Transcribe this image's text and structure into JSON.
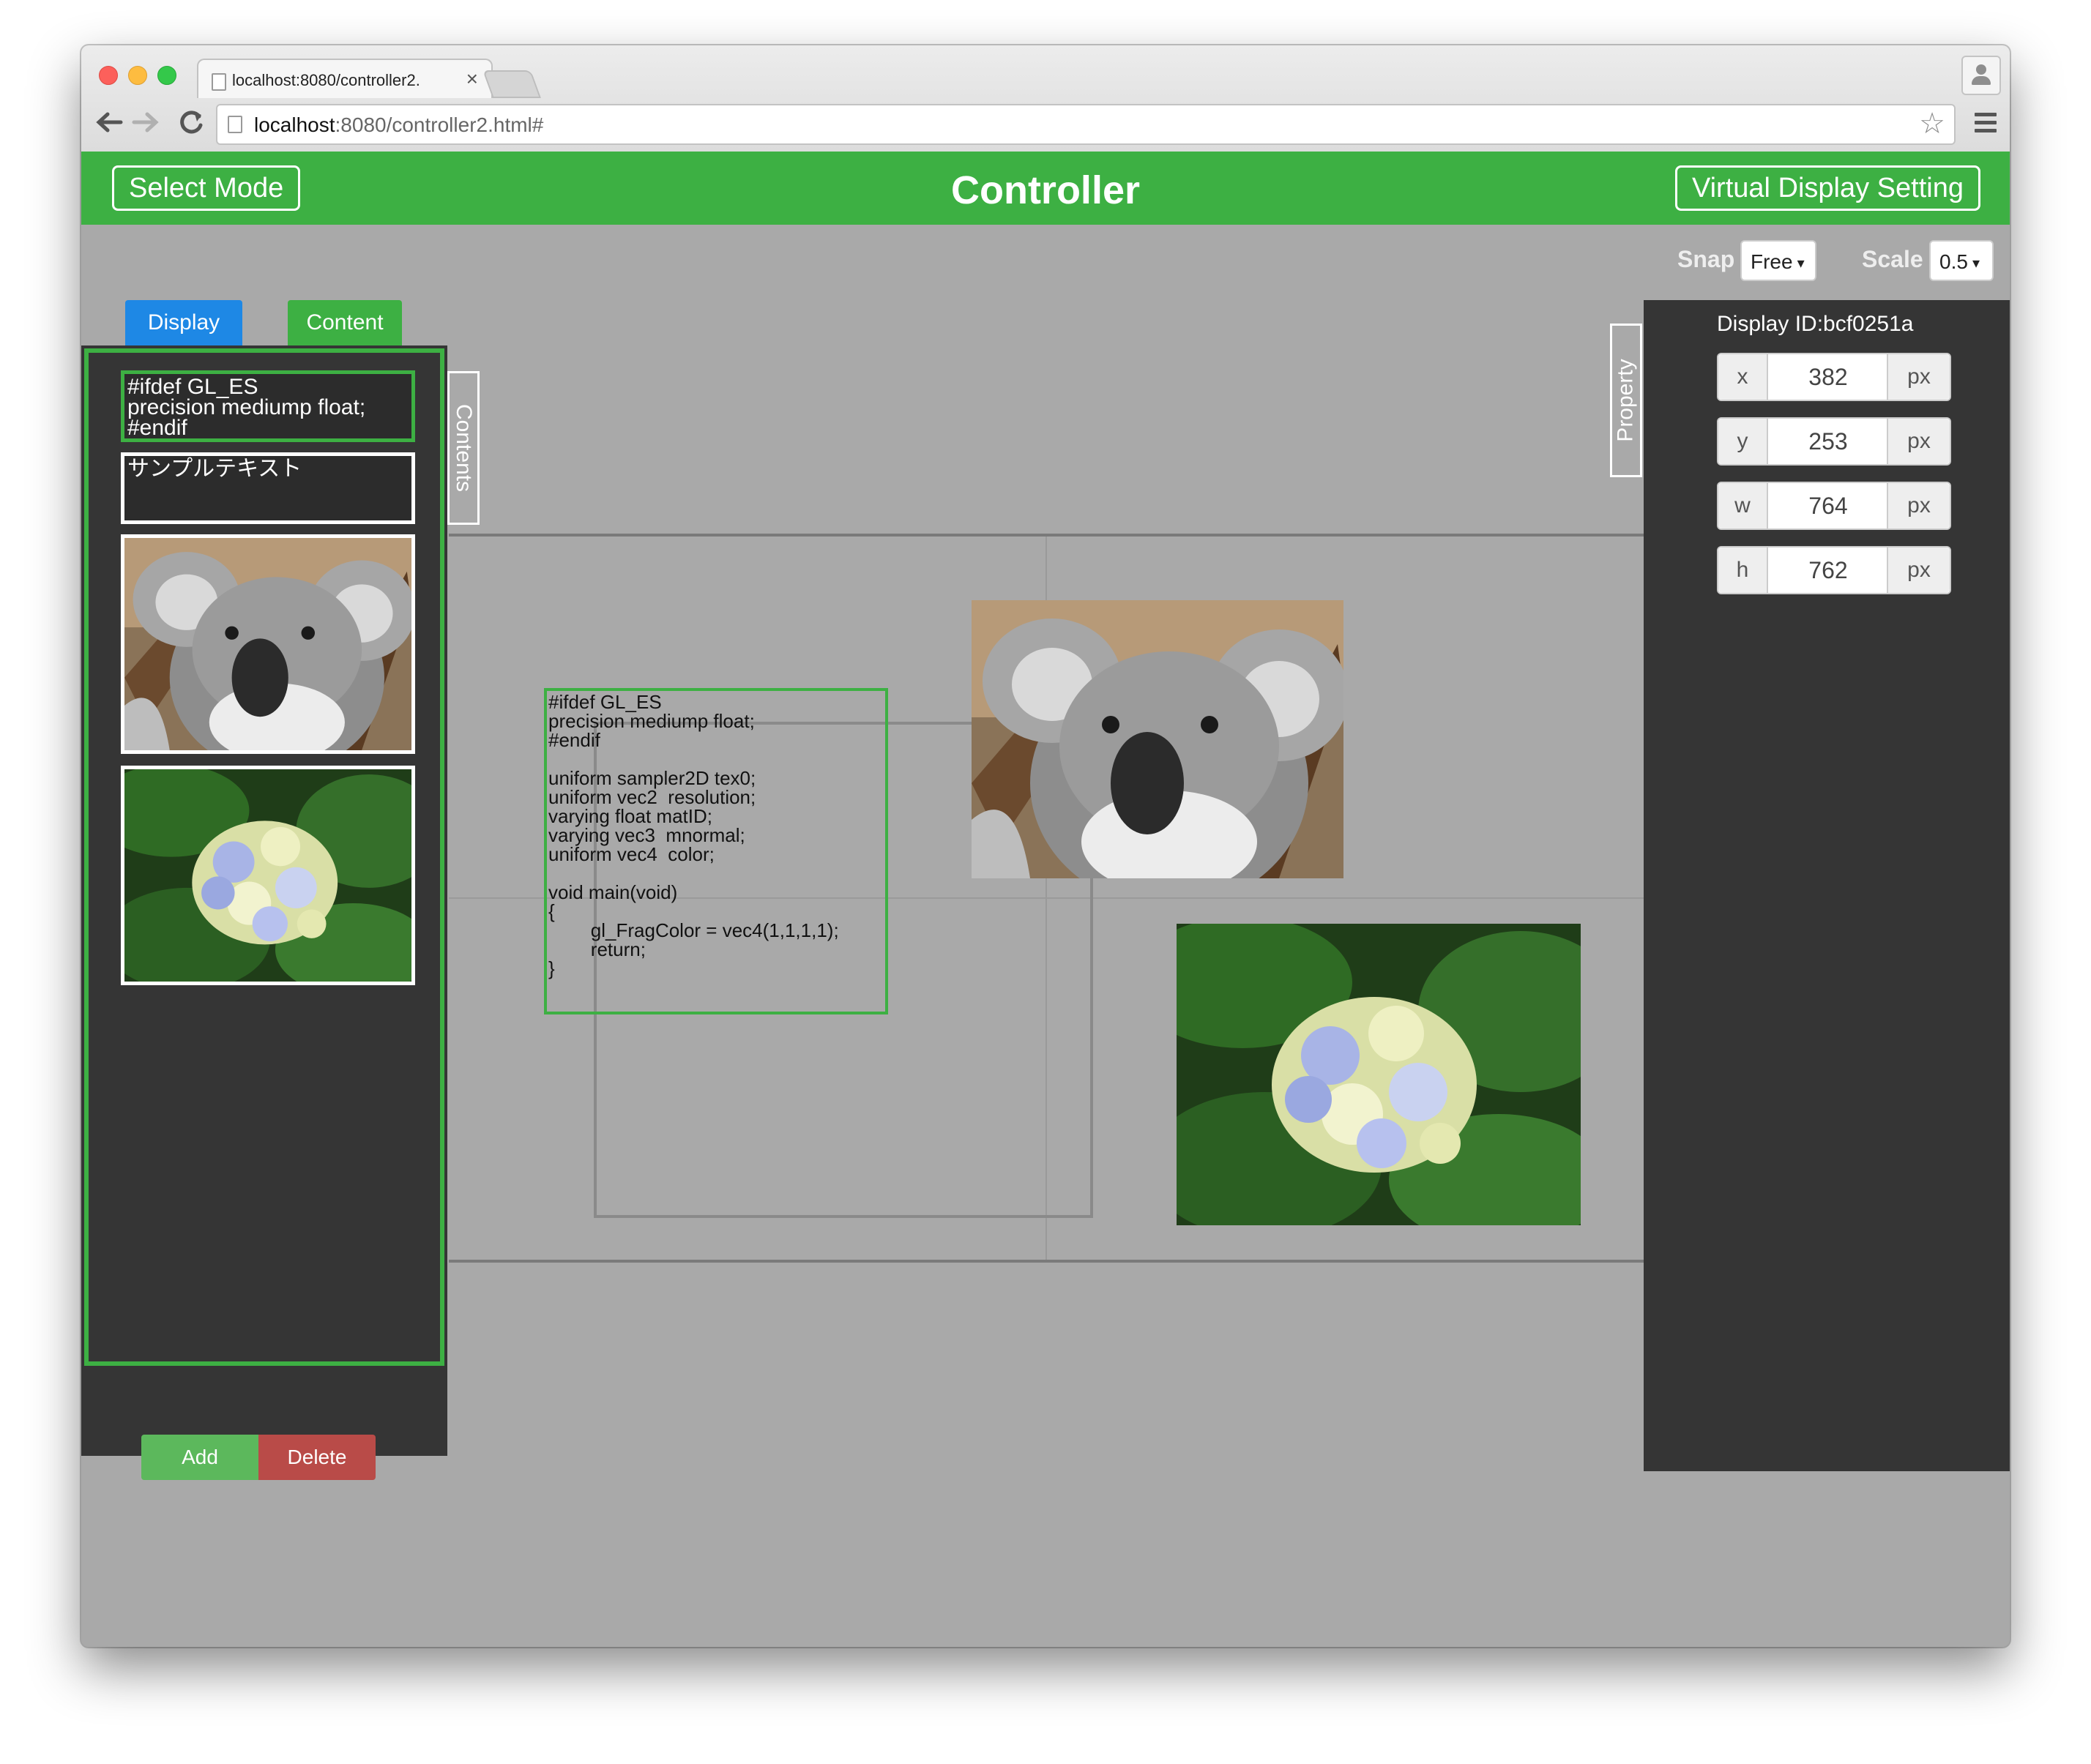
{
  "browser": {
    "tab_title": "localhost:8080/controller2.",
    "tab_close": "×",
    "url_host": "localhost",
    "url_path": ":8080/controller2.html#",
    "icons": [
      "back-arrow-icon",
      "forward-arrow-icon",
      "reload-icon",
      "star-icon",
      "hamburger-menu-icon",
      "profile-icon"
    ]
  },
  "header": {
    "select_mode": "Select Mode",
    "title": "Controller",
    "virtual_display": "Virtual Display Setting",
    "color": "#3db043"
  },
  "toolbar": {
    "snap_label": "Snap",
    "snap_value": "Free",
    "scale_label": "Scale",
    "scale_value": "0.5"
  },
  "left_panel": {
    "tabs": [
      {
        "label": "Display",
        "color": "#1e88e5"
      },
      {
        "label": "Content",
        "color": "#3db043"
      }
    ],
    "side_label": "Contents",
    "items": [
      {
        "type": "text",
        "text": "#ifdef GL_ES\nprecision mediump float;\n#endif",
        "selected": true
      },
      {
        "type": "text",
        "text": "サンプルテキスト",
        "selected": false
      },
      {
        "type": "image",
        "subject": "koala"
      },
      {
        "type": "image",
        "subject": "hydrangea"
      }
    ],
    "add_label": "Add",
    "delete_label": "Delete"
  },
  "canvas": {
    "shader_text": "#ifdef GL_ES\nprecision mediump float;\n#endif\n\nuniform sampler2D tex0;\nuniform vec2  resolution;\nvarying float matID;\nvarying vec3  mnormal;\nuniform vec4  color;\n\nvoid main(void)\n{\n        gl_FragColor = vec4(1,1,1,1);\n        return;\n}"
  },
  "right_panel": {
    "side_label": "Property",
    "display_id": "Display ID:bcf0251a",
    "props": [
      {
        "key": "x",
        "value": "382",
        "unit": "px"
      },
      {
        "key": "y",
        "value": "253",
        "unit": "px"
      },
      {
        "key": "w",
        "value": "764",
        "unit": "px"
      },
      {
        "key": "h",
        "value": "762",
        "unit": "px"
      }
    ]
  }
}
